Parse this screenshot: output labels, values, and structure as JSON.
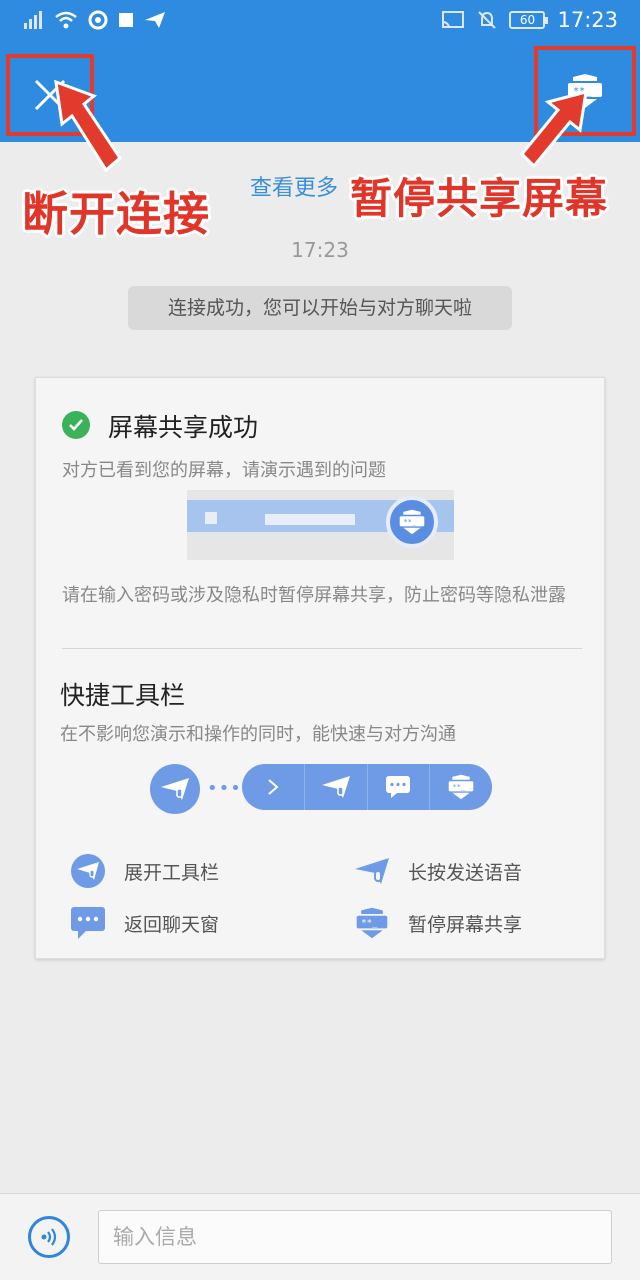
{
  "status_bar": {
    "time": "17:23",
    "battery": "60",
    "icons": [
      "signal-icon",
      "wifi-icon",
      "lifebuoy-icon",
      "stop-icon",
      "send-icon",
      "cast-icon",
      "mute-bell-icon"
    ]
  },
  "app_bar": {
    "close_icon": "close-icon",
    "pause_icon": "privacy-shield-icon"
  },
  "annotations": {
    "disconnect": "断开连接",
    "pause_share": "暂停共享屏幕",
    "color": "#e03528"
  },
  "chat": {
    "more_link": "查看更多",
    "timestamp": "17:23",
    "system_message": "连接成功，您可以开始与对方聊天啦"
  },
  "card": {
    "title": "屏幕共享成功",
    "subtitle": "对方已看到您的屏幕，请演示遇到的问题",
    "note": "请在输入密码或涉及隐私时暂停屏幕共享，防止密码等隐私泄露",
    "toolbar_title": "快捷工具栏",
    "toolbar_subtitle": "在不影响您演示和操作的同时，能快速与对方沟通",
    "legend": [
      {
        "icon": "expand-toolbar-icon",
        "label": "展开工具栏"
      },
      {
        "icon": "voice-plane-icon",
        "label": "长按发送语音"
      },
      {
        "icon": "chat-bubble-icon",
        "label": "返回聊天窗"
      },
      {
        "icon": "privacy-shield-icon",
        "label": "暂停屏幕共享"
      }
    ]
  },
  "input": {
    "placeholder": "输入信息",
    "voice_icon": "voice-icon"
  },
  "colors": {
    "primary": "#2f8be0",
    "accent_blue": "#6f9be6",
    "success": "#3bb15a",
    "annotation_red": "#e23b2e"
  }
}
